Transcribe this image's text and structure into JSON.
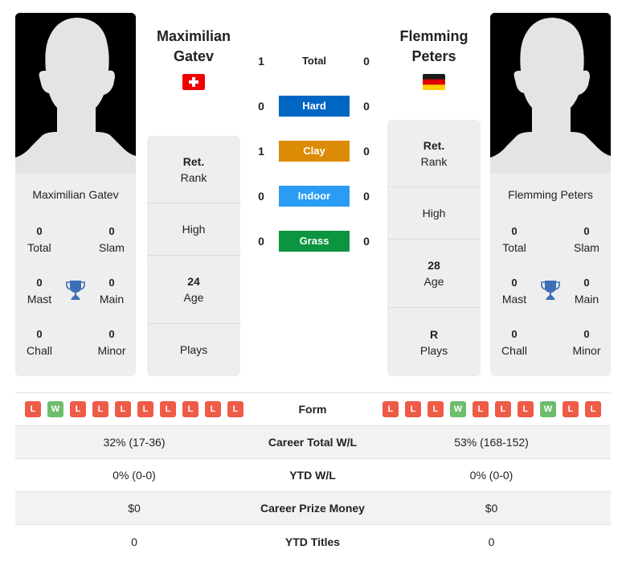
{
  "players": {
    "left": {
      "name_line1": "Maximilian",
      "name_line2": "Gatev",
      "full_name": "Maximilian Gatev",
      "flag": "switzerland-flag",
      "titles": {
        "total": {
          "value": "0",
          "label": "Total"
        },
        "slam": {
          "value": "0",
          "label": "Slam"
        },
        "mast": {
          "value": "0",
          "label": "Mast"
        },
        "main": {
          "value": "0",
          "label": "Main"
        },
        "chall": {
          "value": "0",
          "label": "Chall"
        },
        "minor": {
          "value": "0",
          "label": "Minor"
        }
      },
      "info": {
        "rank": {
          "value": "Ret.",
          "label": "Rank"
        },
        "high": {
          "value": "",
          "label": "High"
        },
        "age": {
          "value": "24",
          "label": "Age"
        },
        "plays": {
          "value": "",
          "label": "Plays"
        }
      },
      "form": [
        "L",
        "W",
        "L",
        "L",
        "L",
        "L",
        "L",
        "L",
        "L",
        "L"
      ]
    },
    "right": {
      "name_line1": "Flemming",
      "name_line2": "Peters",
      "full_name": "Flemming Peters",
      "flag": "germany-flag",
      "titles": {
        "total": {
          "value": "0",
          "label": "Total"
        },
        "slam": {
          "value": "0",
          "label": "Slam"
        },
        "mast": {
          "value": "0",
          "label": "Mast"
        },
        "main": {
          "value": "0",
          "label": "Main"
        },
        "chall": {
          "value": "0",
          "label": "Chall"
        },
        "minor": {
          "value": "0",
          "label": "Minor"
        }
      },
      "info": {
        "rank": {
          "value": "Ret.",
          "label": "Rank"
        },
        "high": {
          "value": "",
          "label": "High"
        },
        "age": {
          "value": "28",
          "label": "Age"
        },
        "plays": {
          "value": "R",
          "label": "Plays"
        }
      },
      "form": [
        "L",
        "L",
        "L",
        "W",
        "L",
        "L",
        "L",
        "W",
        "L",
        "L"
      ]
    }
  },
  "h2h": [
    {
      "label": "Total",
      "left": "1",
      "right": "0",
      "color": ""
    },
    {
      "label": "Hard",
      "left": "0",
      "right": "0",
      "color": "#0066c4"
    },
    {
      "label": "Clay",
      "left": "1",
      "right": "0",
      "color": "#dc8b06"
    },
    {
      "label": "Indoor",
      "left": "0",
      "right": "0",
      "color": "#2b9cf3"
    },
    {
      "label": "Grass",
      "left": "0",
      "right": "0",
      "color": "#0c9440"
    }
  ],
  "stats": {
    "form_label": "Form",
    "rows": [
      {
        "label": "Career Total W/L",
        "left": "32% (17-36)",
        "right": "53% (168-152)"
      },
      {
        "label": "YTD W/L",
        "left": "0% (0-0)",
        "right": "0% (0-0)"
      },
      {
        "label": "Career Prize Money",
        "left": "$0",
        "right": "$0"
      },
      {
        "label": "YTD Titles",
        "left": "0",
        "right": "0"
      }
    ]
  },
  "colors": {
    "loss": "#ee5b47",
    "win": "#6dbd6d",
    "trophy": "#3d6fb8",
    "card_bg": "#eeeeee"
  }
}
